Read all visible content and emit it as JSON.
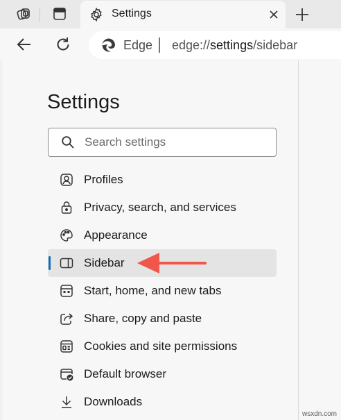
{
  "tabstrip": {
    "active_tab_title": "Settings"
  },
  "toolbar": {
    "site_label": "Edge",
    "url_scheme": "edge://",
    "url_host": "settings",
    "url_path": "/sidebar"
  },
  "settings": {
    "title": "Settings",
    "search": {
      "placeholder": "Search settings",
      "value": ""
    },
    "nav_items": [
      {
        "label": "Profiles",
        "icon": "profiles-icon"
      },
      {
        "label": "Privacy, search, and services",
        "icon": "lock-icon"
      },
      {
        "label": "Appearance",
        "icon": "palette-icon"
      },
      {
        "label": "Sidebar",
        "icon": "sidebar-icon",
        "selected": true
      },
      {
        "label": "Start, home, and new tabs",
        "icon": "start-home-icon"
      },
      {
        "label": "Share, copy and paste",
        "icon": "share-icon"
      },
      {
        "label": "Cookies and site permissions",
        "icon": "cookies-permissions-icon"
      },
      {
        "label": "Default browser",
        "icon": "default-browser-icon"
      },
      {
        "label": "Downloads",
        "icon": "download-icon"
      }
    ]
  },
  "colors": {
    "accent": "#0f6cbd",
    "annotation_arrow": "#f0574a"
  },
  "watermark": "wsxdn.com"
}
